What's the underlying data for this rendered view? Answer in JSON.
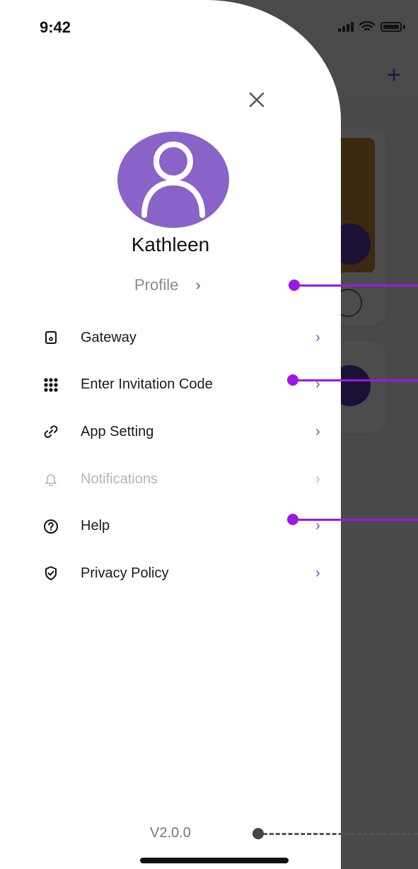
{
  "status_bar": {
    "time": "9:42"
  },
  "background_app": {
    "add_label": "+"
  },
  "drawer": {
    "user_name": "Kathleen",
    "profile_label": "Profile",
    "chevron": "›",
    "menu": [
      {
        "label": "Gateway",
        "icon": "gateway-icon",
        "disabled": false
      },
      {
        "label": "Enter Invitation Code",
        "icon": "keypad-icon",
        "disabled": false
      },
      {
        "label": "App Setting",
        "icon": "link-icon",
        "disabled": false
      },
      {
        "label": "Notifications",
        "icon": "bell-icon",
        "disabled": true
      },
      {
        "label": "Help",
        "icon": "help-icon",
        "disabled": false
      },
      {
        "label": "Privacy Policy",
        "icon": "shield-check-icon",
        "disabled": false
      }
    ],
    "version": "V2.0.0"
  },
  "colors": {
    "accent": "#6b4bc8",
    "avatar": "#8560c7",
    "callout": "#9b18e8",
    "disabled_text": "#b5b5b8"
  }
}
